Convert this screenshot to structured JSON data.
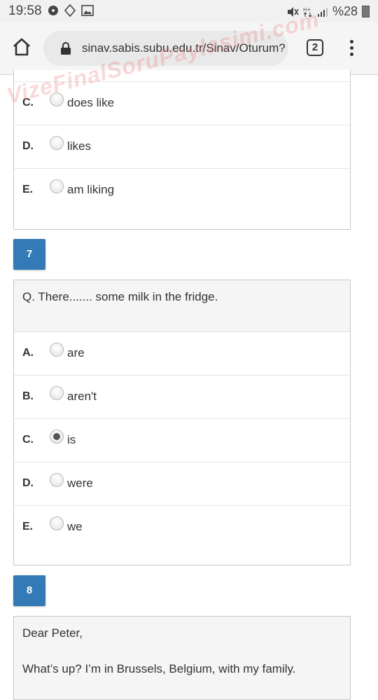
{
  "status_bar": {
    "time": "19:58",
    "icons": [
      "media-icon",
      "location-icon",
      "image-icon"
    ],
    "right_icons": [
      "mute-icon",
      "data-icon",
      "signal-icon"
    ],
    "battery": "%28"
  },
  "browser": {
    "url": "sinav.sabis.subu.edu.tr/Sinav/Oturum?",
    "tab_count": "2"
  },
  "watermark": "VizeFinalSoruPaylasimi.com",
  "previous_question": {
    "options": [
      {
        "letter": "C.",
        "text": "does like",
        "checked": false
      },
      {
        "letter": "D.",
        "text": "likes",
        "checked": false
      },
      {
        "letter": "E.",
        "text": "am liking",
        "checked": false
      }
    ]
  },
  "question7": {
    "number": "7",
    "text": "Q. There....... some milk in the fridge.",
    "options": [
      {
        "letter": "A.",
        "text": "are",
        "checked": false
      },
      {
        "letter": "B.",
        "text": "aren't",
        "checked": false
      },
      {
        "letter": "C.",
        "text": "is",
        "checked": true
      },
      {
        "letter": "D.",
        "text": "were",
        "checked": false
      },
      {
        "letter": "E.",
        "text": "we",
        "checked": false
      }
    ]
  },
  "question8": {
    "number": "8",
    "lines": [
      "Dear Peter,",
      "What’s up? I’m in Brussels, Belgium, with my family."
    ]
  }
}
